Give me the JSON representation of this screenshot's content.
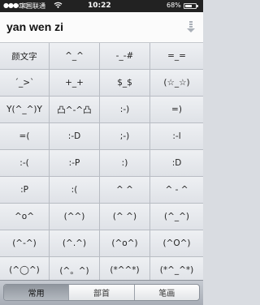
{
  "status_bar": {
    "signal": "●●●○○",
    "carrier": "中国联通",
    "wifi_icon": "wifi-icon",
    "time": "10:22",
    "battery_percent": "68%",
    "battery_level": 0.68
  },
  "header": {
    "title": "yan wen zi",
    "action_icon": "download-arrow-icon"
  },
  "grid": {
    "rows": [
      [
        "颜文字",
        "^_^",
        "-_-#",
        "=_="
      ],
      [
        "´_>`",
        "+_+",
        "$_$",
        "(☆_☆)"
      ],
      [
        "Y(^_^)Y",
        "凸^-^凸",
        ":-)",
        "=)"
      ],
      [
        "=(",
        ":-D",
        ";-)",
        ":-l"
      ],
      [
        ":-(",
        ":-P",
        ":)",
        ":D"
      ],
      [
        ":P",
        ":(",
        "^ ^",
        "^ - ^"
      ],
      [
        "^o^",
        "(^^)",
        "(^ ^)",
        "(^_^)"
      ],
      [
        "(^-^)",
        "(^.^)",
        "(^o^)",
        "(^O^)"
      ],
      [
        "(^◯^)",
        "(^。^)",
        "(*^^*)",
        "(*^_^*)"
      ]
    ]
  },
  "tabs": {
    "items": [
      "常用",
      "部首",
      "笔画"
    ],
    "selected": 0
  }
}
